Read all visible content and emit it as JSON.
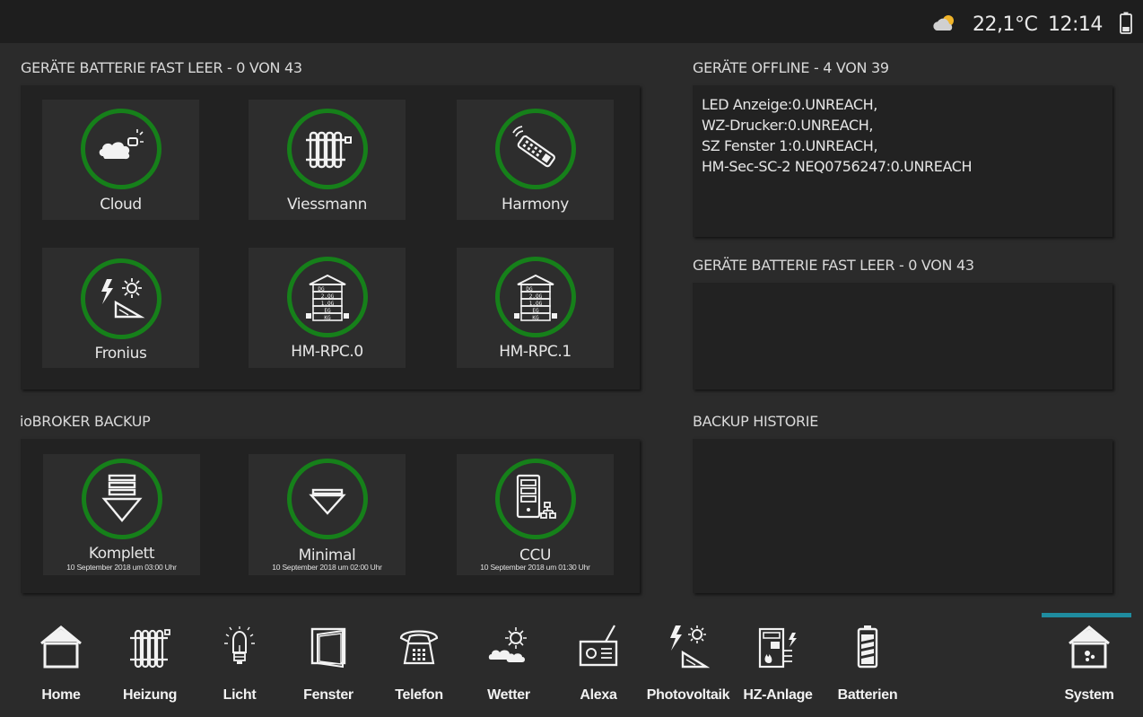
{
  "status_bar": {
    "weather_icon": "partly-cloudy-icon",
    "temperature": "22,1°C",
    "time": "12:14",
    "battery_icon": "battery-icon"
  },
  "battery_section": {
    "title": "GERÄTE BATTERIE FAST LEER - 0 VON 43",
    "tiles": [
      {
        "label": "Cloud",
        "icon": "cloud-service-icon"
      },
      {
        "label": "Viessmann",
        "icon": "radiator-icon"
      },
      {
        "label": "Harmony",
        "icon": "remote-control-icon"
      },
      {
        "label": "Fronius",
        "icon": "photovoltaic-icon"
      },
      {
        "label": "HM-RPC.0",
        "icon": "house-floors-icon"
      },
      {
        "label": "HM-RPC.1",
        "icon": "house-floors-icon"
      }
    ]
  },
  "offline_section": {
    "title": "GERÄTE OFFLINE - 4 VON 39",
    "lines": [
      "LED Anzeige:0.UNREACH,",
      "WZ-Drucker:0.UNREACH,",
      "SZ Fenster 1:0.UNREACH,",
      "HM-Sec-SC-2 NEQ0756247:0.UNREACH"
    ]
  },
  "battery_section_right": {
    "title": "GERÄTE BATTERIE FAST LEER - 0 VON 43"
  },
  "backup_section": {
    "title": "ioBROKER BACKUP",
    "tiles": [
      {
        "label": "Komplett",
        "sub": "10 September 2018 um 03:00 Uhr",
        "icon": "backup-full-icon"
      },
      {
        "label": "Minimal",
        "sub": "10 September 2018 um 02:00 Uhr",
        "icon": "backup-minimal-icon"
      },
      {
        "label": "CCU",
        "sub": "10 September 2018 um 01:30 Uhr",
        "icon": "server-network-icon"
      }
    ]
  },
  "backup_history": {
    "title": "BACKUP HISTORIE"
  },
  "nav": {
    "items": [
      {
        "label": "Home",
        "icon": "home-icon"
      },
      {
        "label": "Heizung",
        "icon": "radiator-icon"
      },
      {
        "label": "Licht",
        "icon": "light-bulb-icon"
      },
      {
        "label": "Fenster",
        "icon": "window-icon"
      },
      {
        "label": "Telefon",
        "icon": "telephone-icon"
      },
      {
        "label": "Wetter",
        "icon": "weather-icon"
      },
      {
        "label": "Alexa",
        "icon": "radio-icon"
      },
      {
        "label": "Photovoltaik",
        "icon": "photovoltaic-icon"
      },
      {
        "label": "HZ-Anlage",
        "icon": "heating-system-icon"
      },
      {
        "label": "Batterien",
        "icon": "battery-icon"
      },
      {
        "label": "System",
        "icon": "system-house-icon"
      }
    ],
    "active": "System",
    "active_color": "#1f8c9f"
  },
  "colors": {
    "ring": "#16801a",
    "panel": "#222222",
    "tile": "#2d2d2d",
    "background": "#2b2b2b",
    "topbar": "#1e1e1e"
  }
}
